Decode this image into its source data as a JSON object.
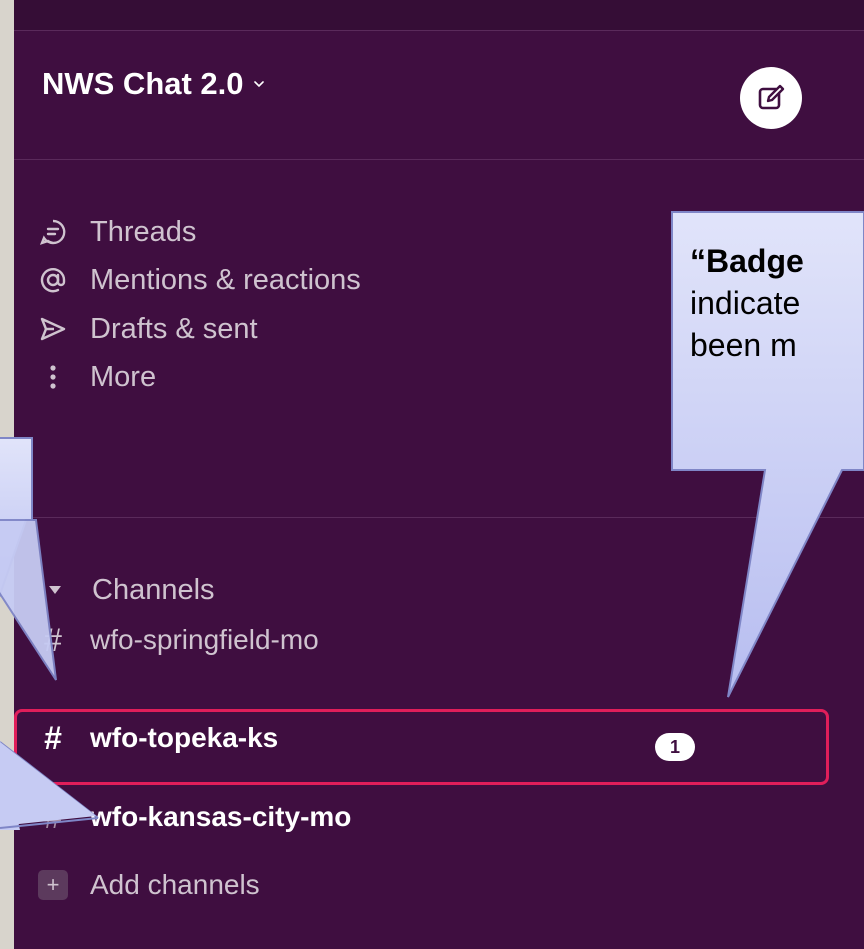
{
  "workspace": {
    "name": "NWS Chat 2.0",
    "chevron": "chevron-down-icon"
  },
  "compose": {
    "icon": "compose-icon"
  },
  "nav": [
    {
      "label": "Threads",
      "icon": "threads-icon"
    },
    {
      "label": "Mentions & reactions",
      "icon": "at-icon"
    },
    {
      "label": "Drafts & sent",
      "icon": "send-icon"
    },
    {
      "label": "More",
      "icon": "more-vertical-icon"
    }
  ],
  "channels_section": {
    "label": "Channels",
    "icon": "caret-down-icon"
  },
  "channels": [
    {
      "name": "wfo-springfield-mo",
      "unread": false
    },
    {
      "name": "wfo-topeka-ks",
      "unread": true,
      "badge": "1"
    },
    {
      "name": "wfo-kansas-city-mo",
      "unread": true
    }
  ],
  "add_channels": {
    "label": "Add channels",
    "icon": "plus-icon"
  },
  "callout": {
    "title": "“Badge",
    "line2": "indicate",
    "line3": "been m"
  },
  "colors": {
    "sidebar_bg": "#3f0e40",
    "highlight_border": "#e01e5a",
    "callout_fill": "#c9cef5",
    "callout_stroke": "#7f86c7",
    "text_muted": "#cfc3cf"
  }
}
